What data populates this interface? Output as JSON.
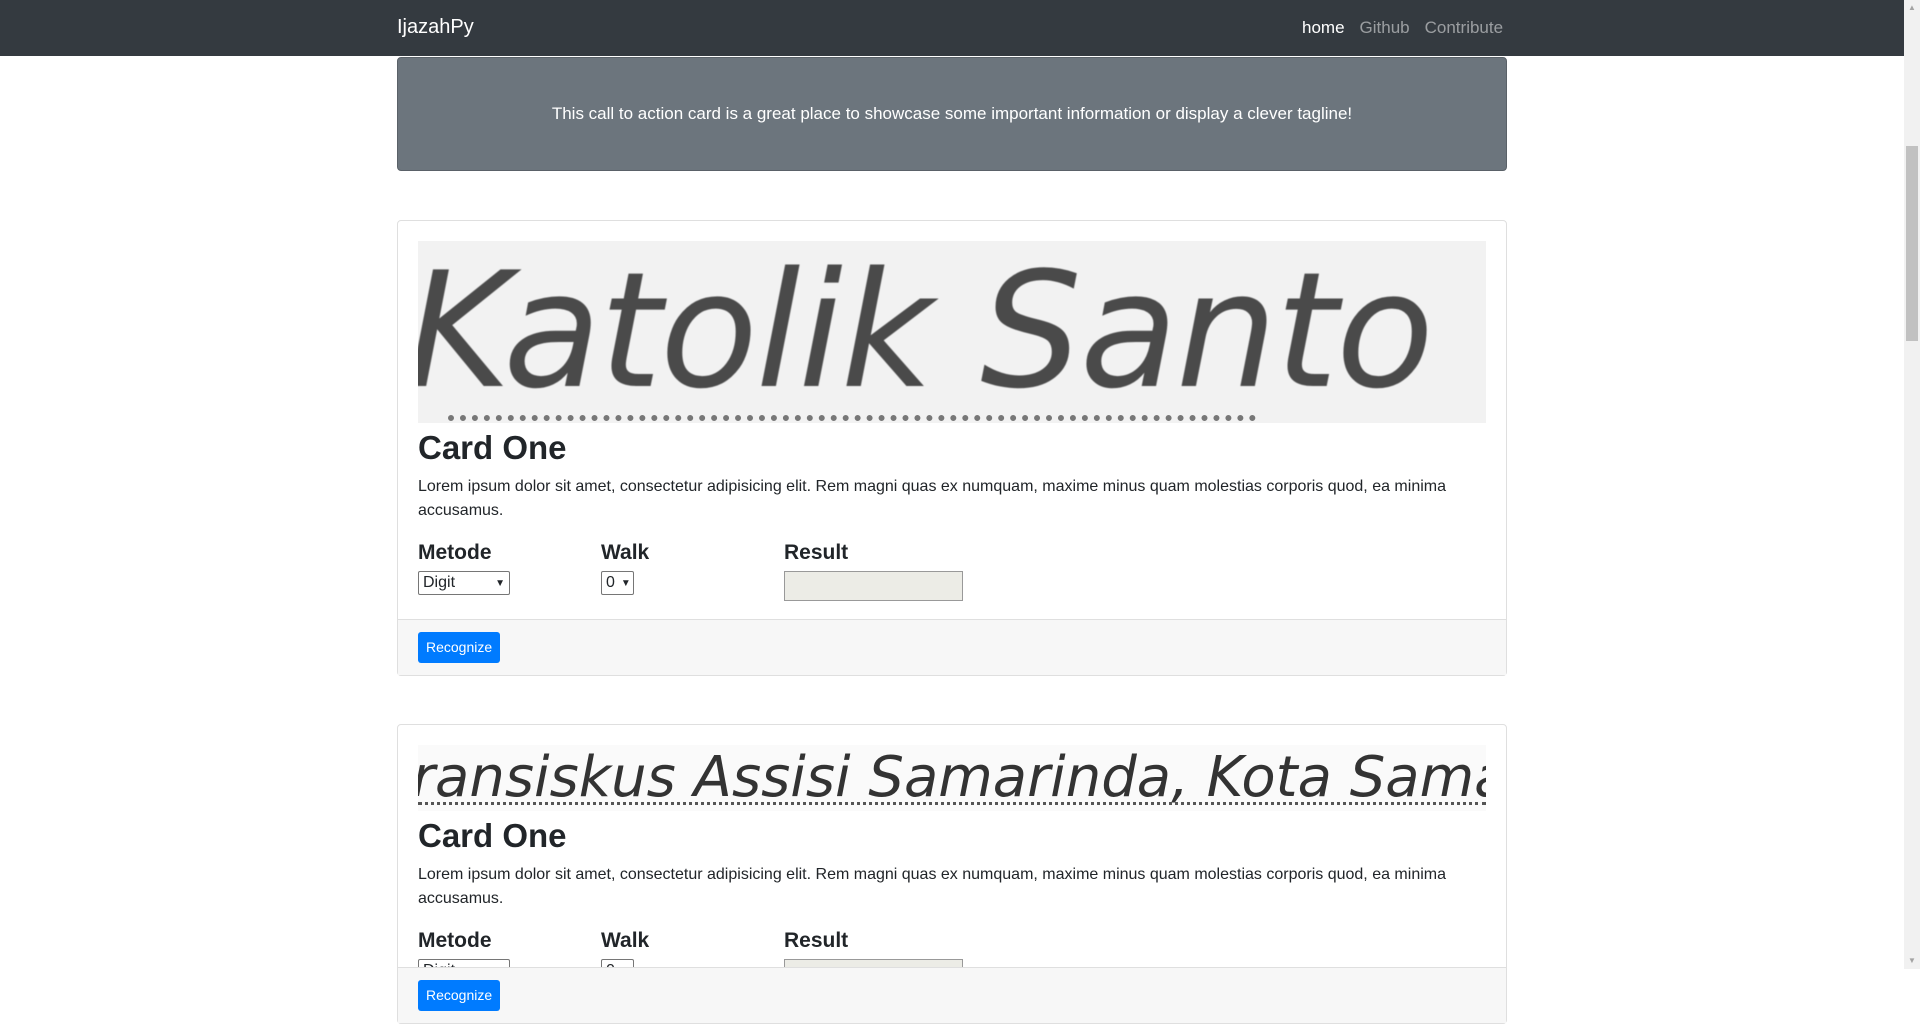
{
  "navbar": {
    "brand": "IjazahPy",
    "links": [
      {
        "label": "home",
        "active": true
      },
      {
        "label": "Github",
        "active": false
      },
      {
        "label": "Contribute",
        "active": false
      }
    ]
  },
  "cta": {
    "text": "This call to action card is a great place to showcase some important information or display a clever tagline!"
  },
  "cards": [
    {
      "image_text": "Katolik Santo",
      "title": "Card One",
      "text": "Lorem ipsum dolor sit amet, consectetur adipisicing elit. Rem magni quas ex numquam, maxime minus quam molestias corporis quod, ea minima accusamus.",
      "metode_label": "Metode",
      "metode_value": "Digit",
      "walk_label": "Walk",
      "walk_value": "0",
      "result_label": "Result",
      "result_value": "",
      "button_label": "Recognize"
    },
    {
      "image_text": "ransiskus Assisi Samarinda, Kota Samarinda",
      "title": "Card One",
      "text": "Lorem ipsum dolor sit amet, consectetur adipisicing elit. Rem magni quas ex numquam, maxime minus quam molestias corporis quod, ea minima accusamus.",
      "metode_label": "Metode",
      "metode_value": "Digit",
      "walk_label": "Walk",
      "walk_value": "0",
      "result_label": "Result",
      "result_value": "",
      "button_label": "Recognize"
    }
  ],
  "colors": {
    "navbar_bg": "#343a40",
    "cta_bg": "#6c757d",
    "button_primary": "#007bff"
  }
}
